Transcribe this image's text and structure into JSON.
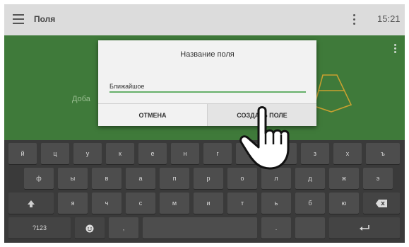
{
  "appbar": {
    "title": "Поля",
    "clock": "15:21"
  },
  "content": {
    "add_hint": "Доба"
  },
  "dialog": {
    "title": "Название поля",
    "input_value": "Ближайшое",
    "cancel_label": "ОТМЕНА",
    "create_label": "СОЗДАТЬ ПОЛЕ"
  },
  "keyboard": {
    "row1": [
      "й",
      "ц",
      "у",
      "к",
      "е",
      "н",
      "г",
      "ш",
      "щ",
      "з",
      "х",
      "ъ"
    ],
    "row2": [
      "ф",
      "ы",
      "в",
      "а",
      "п",
      "р",
      "о",
      "л",
      "д",
      "ж",
      "э"
    ],
    "row3": [
      "я",
      "ч",
      "с",
      "м",
      "и",
      "т",
      "ь",
      "б",
      "ю"
    ],
    "symbols_key": "?123",
    "comma_key": ",",
    "period_key": "."
  },
  "colors": {
    "map_green": "#3f7a3a",
    "accent": "#66b06a",
    "field_outline": "#c8a030"
  }
}
